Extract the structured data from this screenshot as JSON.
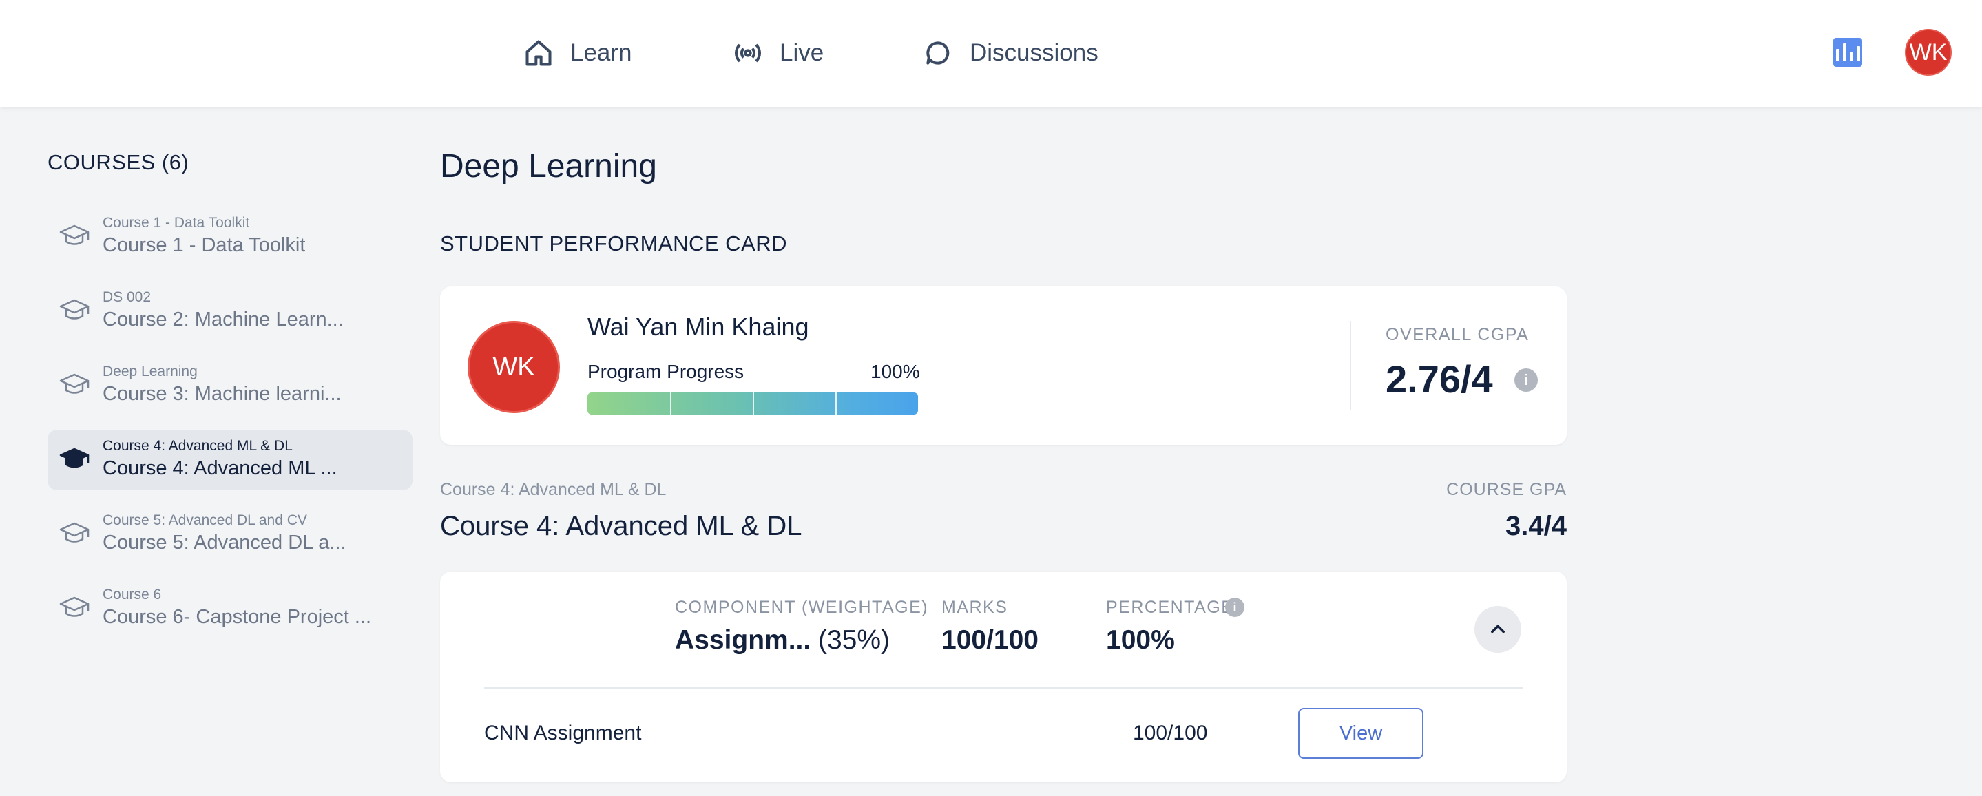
{
  "nav": {
    "items": [
      {
        "label": "Learn",
        "icon": "home-icon"
      },
      {
        "label": "Live",
        "icon": "broadcast-icon"
      },
      {
        "label": "Discussions",
        "icon": "chat-bubble-icon"
      }
    ],
    "stats_icon": "bar-chart-icon",
    "avatar_initials": "WK"
  },
  "sidebar": {
    "title": "COURSES (6)",
    "items": [
      {
        "sub": "Course 1 - Data Toolkit",
        "label": "Course 1 - Data Toolkit",
        "active": false
      },
      {
        "sub": "DS 002",
        "label": "Course 2: Machine Learn...",
        "active": false
      },
      {
        "sub": "Deep Learning",
        "label": "Course 3: Machine learni...",
        "active": false
      },
      {
        "sub": "Course 4: Advanced ML & DL",
        "label": "Course 4: Advanced ML ...",
        "active": true
      },
      {
        "sub": "Course 5: Advanced DL and CV",
        "label": "Course 5: Advanced DL a...",
        "active": false
      },
      {
        "sub": "Course 6",
        "label": "Course 6- Capstone Project ...",
        "active": false
      }
    ]
  },
  "main": {
    "title": "Deep Learning",
    "section_title": "STUDENT PERFORMANCE CARD",
    "performance": {
      "avatar_initials": "WK",
      "student_name": "Wai Yan Min Khaing",
      "progress_label": "Program Progress",
      "progress_value": "100%",
      "progress_fraction": 1.0,
      "cgpa_label": "OVERALL CGPA",
      "cgpa_value": "2.76/4",
      "info_glyph": "i"
    },
    "course": {
      "sub": "Course 4: Advanced ML & DL",
      "name": "Course 4: Advanced ML & DL",
      "gpa_label": "COURSE GPA",
      "gpa_value": "3.4/4"
    },
    "components": {
      "headers": {
        "component": "COMPONENT (WEIGHTAGE)",
        "marks": "MARKS",
        "percentage": "PERCENTAGE"
      },
      "row": {
        "component": "Assignm...",
        "weightage": "(35%)",
        "marks": "100/100",
        "percentage": "100%"
      },
      "items": [
        {
          "name": "CNN Assignment",
          "marks": "100/100",
          "action": "View"
        }
      ]
    }
  },
  "colors": {
    "accent": "#5b8def",
    "avatar": "#d8342b",
    "background": "#f2f4f6"
  }
}
